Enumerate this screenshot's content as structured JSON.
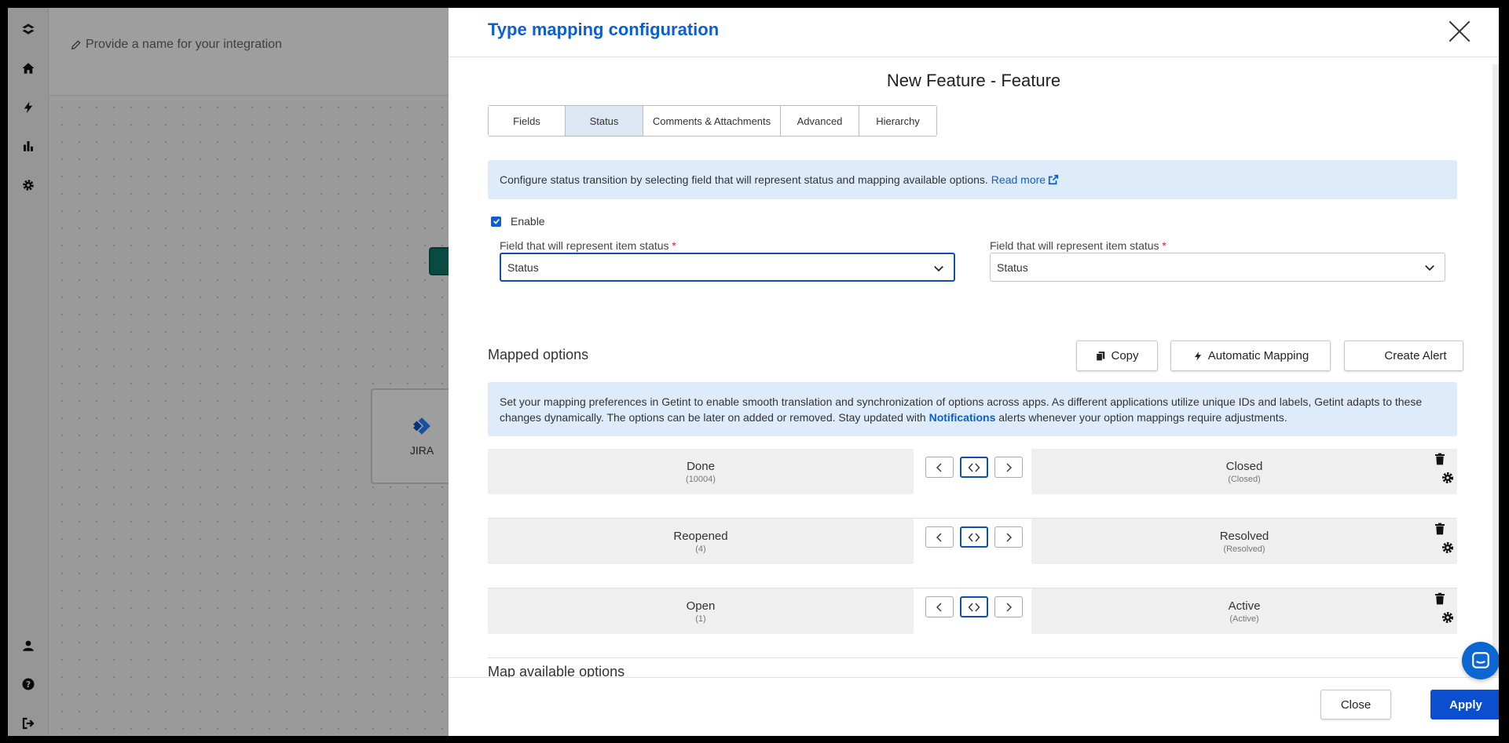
{
  "background": {
    "integration_name_placeholder": "Provide a name for your integration",
    "jira_card_label": "JIRA"
  },
  "modal": {
    "title": "Type mapping configuration",
    "subtitle": "New Feature - Feature",
    "tabs": [
      {
        "label": "Fields",
        "active": false
      },
      {
        "label": "Status",
        "active": true
      },
      {
        "label": "Comments & Attachments",
        "active": false
      },
      {
        "label": "Advanced",
        "active": false
      },
      {
        "label": "Hierarchy",
        "active": false
      }
    ],
    "info_banner": {
      "text": "Configure status transition by selecting field that will represent status and mapping available options.",
      "link": "Read more"
    },
    "enable": {
      "label": "Enable",
      "checked": true
    },
    "left_field": {
      "label": "Field that will represent item status",
      "required": "*",
      "value": "Status"
    },
    "right_field": {
      "label": "Field that will represent item status",
      "required": "*",
      "value": "Status"
    },
    "mapped_options": {
      "title": "Mapped options",
      "buttons": {
        "copy": "Copy",
        "automatic": "Automatic Mapping",
        "alert": "Create Alert"
      },
      "banner_text_1": "Set your mapping preferences in Getint to enable smooth translation and synchronization of options across apps. As different applications utilize unique IDs and labels, Getint adapts to these changes dynamically. The options can be later on added or removed. Stay updated with",
      "banner_link": "Notifications",
      "banner_text_2": "alerts whenever your option mappings require adjustments.",
      "rows": [
        {
          "left": {
            "name": "Done",
            "id": "(10004)"
          },
          "right": {
            "name": "Closed",
            "id": "(Closed)"
          }
        },
        {
          "left": {
            "name": "Reopened",
            "id": "(4)"
          },
          "right": {
            "name": "Resolved",
            "id": "(Resolved)"
          }
        },
        {
          "left": {
            "name": "Open",
            "id": "(1)"
          },
          "right": {
            "name": "Active",
            "id": "(Active)"
          }
        }
      ]
    },
    "map_available_title": "Map available options",
    "footer": {
      "close": "Close",
      "apply": "Apply"
    }
  },
  "colors": {
    "accent": "#0b5fd1",
    "info_bg": "#deebfb",
    "apply_bg": "#0b4fd0"
  }
}
